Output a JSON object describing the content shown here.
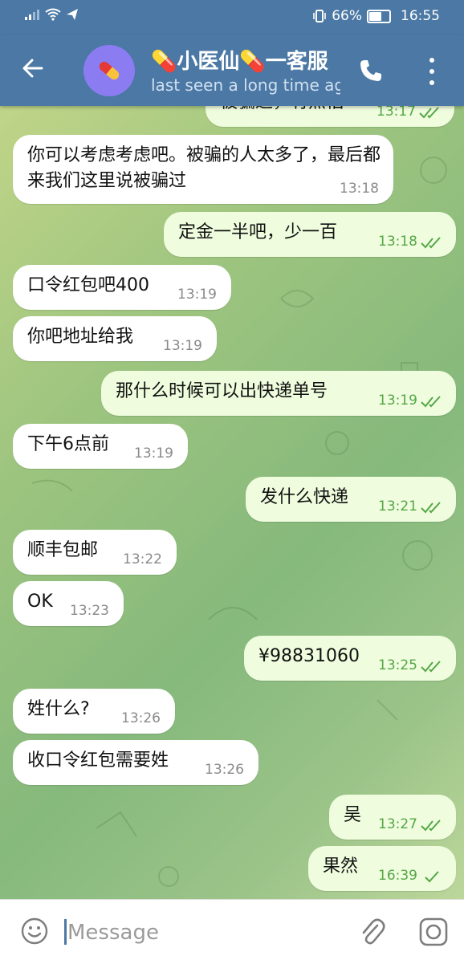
{
  "status_bar": {
    "battery_percent": "66%",
    "clock": "16:55"
  },
  "chat_header": {
    "title": "💊小医仙💊一客服",
    "subtitle": "last seen a long time ago",
    "avatar_icon": "pill-icon"
  },
  "messages": [
    {
      "dir": "out",
      "text": "被骗过，有点怕",
      "time": "13:17",
      "status": "read"
    },
    {
      "dir": "in",
      "text": "你可以考虑考虑吧。被骗的人太多了，最后都来我们这里说被骗过",
      "time": "13:18"
    },
    {
      "dir": "out",
      "text": "定金一半吧，少一百",
      "time": "13:18",
      "status": "read"
    },
    {
      "dir": "in",
      "text": "口令红包吧400",
      "time": "13:19"
    },
    {
      "dir": "in",
      "text": "你吧地址给我",
      "time": "13:19"
    },
    {
      "dir": "out",
      "text": "那什么时候可以出快递单号",
      "time": "13:19",
      "status": "read"
    },
    {
      "dir": "in",
      "text": "下午6点前",
      "time": "13:19"
    },
    {
      "dir": "out",
      "text": "发什么快递",
      "time": "13:21",
      "status": "read"
    },
    {
      "dir": "in",
      "text": "顺丰包邮",
      "time": "13:22"
    },
    {
      "dir": "in",
      "text": "OK",
      "time": "13:23"
    },
    {
      "dir": "out",
      "text": "¥98831060",
      "time": "13:25",
      "status": "read"
    },
    {
      "dir": "in",
      "text": "姓什么?",
      "time": "13:26"
    },
    {
      "dir": "in",
      "text": "收口令红包需要姓",
      "time": "13:26"
    },
    {
      "dir": "out",
      "text": "吴",
      "time": "13:27",
      "status": "read"
    },
    {
      "dir": "out",
      "text": "果然",
      "time": "16:39",
      "status": "sent"
    }
  ],
  "composer": {
    "placeholder": "Message"
  },
  "colors": {
    "header": "#4b78a4",
    "outgoing_bubble": "#effdde",
    "incoming_bubble": "#ffffff",
    "tick": "#55a646"
  }
}
